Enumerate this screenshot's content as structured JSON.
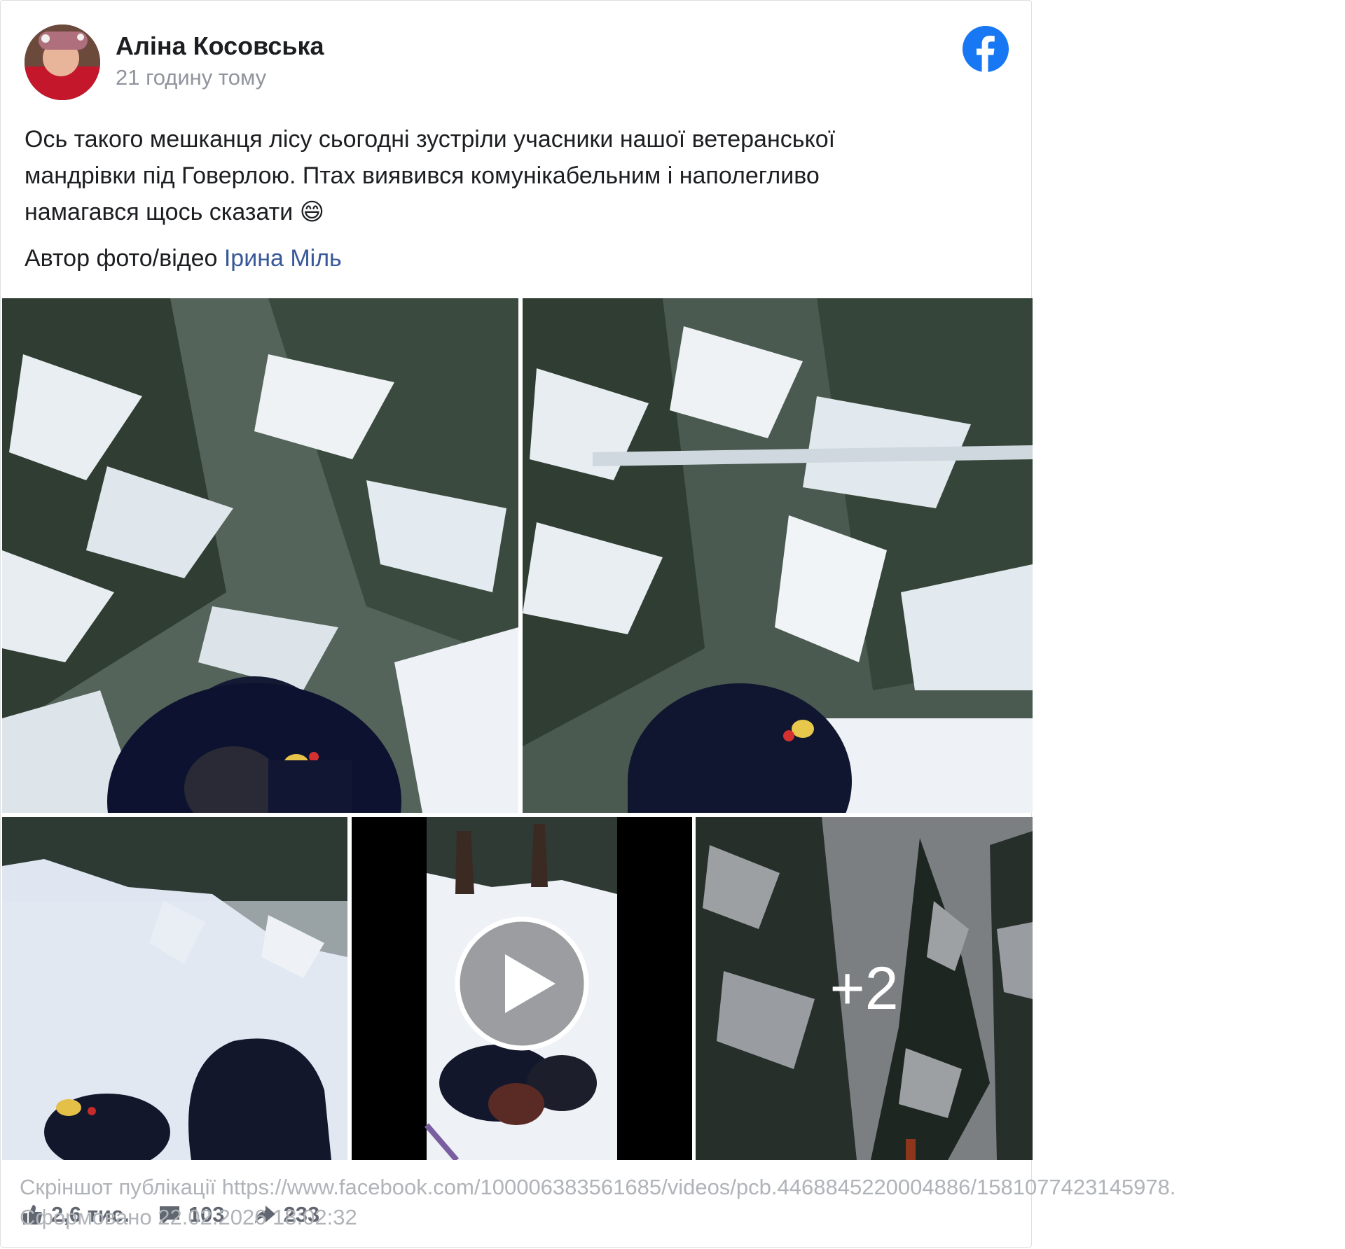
{
  "post": {
    "author": "Аліна Косовська",
    "time": "21 годину тому",
    "text": "Ось такого мешканця лісу сьогодні зустріли учасники нашої ветеранської мандрівки під Говерлою. Птах виявився комунікабельним і наполегливо намагався щось сказати 😄",
    "credit_label": "Автор фото/відео",
    "credit_name": "Ірина Міль"
  },
  "media": {
    "more_count": "+2",
    "icons": [
      "facebook-logo-icon",
      "play-icon"
    ]
  },
  "reactions": {
    "likes": "2,6 тис.",
    "comments": "103",
    "shares": "233"
  },
  "footer": {
    "source": "Скріншот публікації https://www.facebook.com/100006383561685/videos/pcb.4468845220004886/1581077423145978.",
    "formed": "Сформовано 22.02.2026 18:02:32"
  },
  "colors": {
    "facebook_blue": "#1877f2",
    "link": "#385898",
    "muted": "#90949c"
  }
}
